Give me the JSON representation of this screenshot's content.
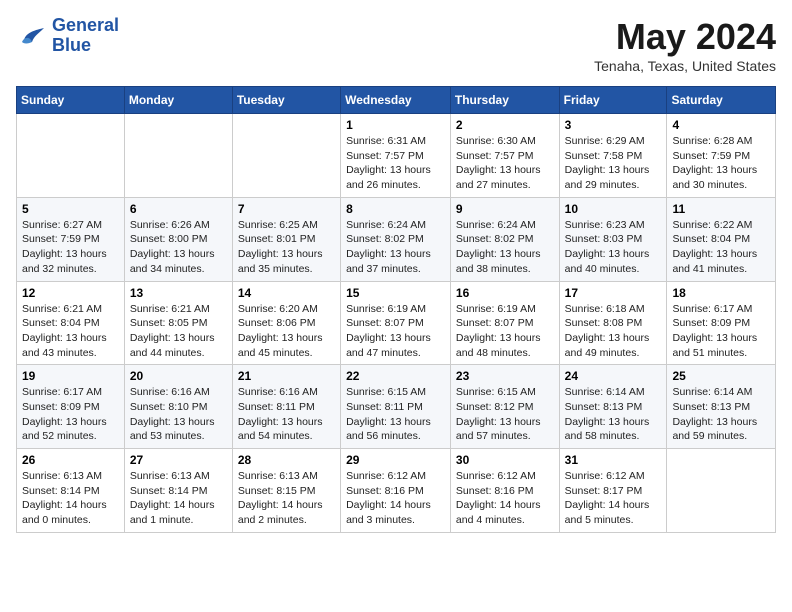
{
  "header": {
    "logo_line1": "General",
    "logo_line2": "Blue",
    "month_year": "May 2024",
    "location": "Tenaha, Texas, United States"
  },
  "days_of_week": [
    "Sunday",
    "Monday",
    "Tuesday",
    "Wednesday",
    "Thursday",
    "Friday",
    "Saturday"
  ],
  "weeks": [
    [
      {
        "day": "",
        "info": ""
      },
      {
        "day": "",
        "info": ""
      },
      {
        "day": "",
        "info": ""
      },
      {
        "day": "1",
        "info": "Sunrise: 6:31 AM\nSunset: 7:57 PM\nDaylight: 13 hours\nand 26 minutes."
      },
      {
        "day": "2",
        "info": "Sunrise: 6:30 AM\nSunset: 7:57 PM\nDaylight: 13 hours\nand 27 minutes."
      },
      {
        "day": "3",
        "info": "Sunrise: 6:29 AM\nSunset: 7:58 PM\nDaylight: 13 hours\nand 29 minutes."
      },
      {
        "day": "4",
        "info": "Sunrise: 6:28 AM\nSunset: 7:59 PM\nDaylight: 13 hours\nand 30 minutes."
      }
    ],
    [
      {
        "day": "5",
        "info": "Sunrise: 6:27 AM\nSunset: 7:59 PM\nDaylight: 13 hours\nand 32 minutes."
      },
      {
        "day": "6",
        "info": "Sunrise: 6:26 AM\nSunset: 8:00 PM\nDaylight: 13 hours\nand 34 minutes."
      },
      {
        "day": "7",
        "info": "Sunrise: 6:25 AM\nSunset: 8:01 PM\nDaylight: 13 hours\nand 35 minutes."
      },
      {
        "day": "8",
        "info": "Sunrise: 6:24 AM\nSunset: 8:02 PM\nDaylight: 13 hours\nand 37 minutes."
      },
      {
        "day": "9",
        "info": "Sunrise: 6:24 AM\nSunset: 8:02 PM\nDaylight: 13 hours\nand 38 minutes."
      },
      {
        "day": "10",
        "info": "Sunrise: 6:23 AM\nSunset: 8:03 PM\nDaylight: 13 hours\nand 40 minutes."
      },
      {
        "day": "11",
        "info": "Sunrise: 6:22 AM\nSunset: 8:04 PM\nDaylight: 13 hours\nand 41 minutes."
      }
    ],
    [
      {
        "day": "12",
        "info": "Sunrise: 6:21 AM\nSunset: 8:04 PM\nDaylight: 13 hours\nand 43 minutes."
      },
      {
        "day": "13",
        "info": "Sunrise: 6:21 AM\nSunset: 8:05 PM\nDaylight: 13 hours\nand 44 minutes."
      },
      {
        "day": "14",
        "info": "Sunrise: 6:20 AM\nSunset: 8:06 PM\nDaylight: 13 hours\nand 45 minutes."
      },
      {
        "day": "15",
        "info": "Sunrise: 6:19 AM\nSunset: 8:07 PM\nDaylight: 13 hours\nand 47 minutes."
      },
      {
        "day": "16",
        "info": "Sunrise: 6:19 AM\nSunset: 8:07 PM\nDaylight: 13 hours\nand 48 minutes."
      },
      {
        "day": "17",
        "info": "Sunrise: 6:18 AM\nSunset: 8:08 PM\nDaylight: 13 hours\nand 49 minutes."
      },
      {
        "day": "18",
        "info": "Sunrise: 6:17 AM\nSunset: 8:09 PM\nDaylight: 13 hours\nand 51 minutes."
      }
    ],
    [
      {
        "day": "19",
        "info": "Sunrise: 6:17 AM\nSunset: 8:09 PM\nDaylight: 13 hours\nand 52 minutes."
      },
      {
        "day": "20",
        "info": "Sunrise: 6:16 AM\nSunset: 8:10 PM\nDaylight: 13 hours\nand 53 minutes."
      },
      {
        "day": "21",
        "info": "Sunrise: 6:16 AM\nSunset: 8:11 PM\nDaylight: 13 hours\nand 54 minutes."
      },
      {
        "day": "22",
        "info": "Sunrise: 6:15 AM\nSunset: 8:11 PM\nDaylight: 13 hours\nand 56 minutes."
      },
      {
        "day": "23",
        "info": "Sunrise: 6:15 AM\nSunset: 8:12 PM\nDaylight: 13 hours\nand 57 minutes."
      },
      {
        "day": "24",
        "info": "Sunrise: 6:14 AM\nSunset: 8:13 PM\nDaylight: 13 hours\nand 58 minutes."
      },
      {
        "day": "25",
        "info": "Sunrise: 6:14 AM\nSunset: 8:13 PM\nDaylight: 13 hours\nand 59 minutes."
      }
    ],
    [
      {
        "day": "26",
        "info": "Sunrise: 6:13 AM\nSunset: 8:14 PM\nDaylight: 14 hours\nand 0 minutes."
      },
      {
        "day": "27",
        "info": "Sunrise: 6:13 AM\nSunset: 8:14 PM\nDaylight: 14 hours\nand 1 minute."
      },
      {
        "day": "28",
        "info": "Sunrise: 6:13 AM\nSunset: 8:15 PM\nDaylight: 14 hours\nand 2 minutes."
      },
      {
        "day": "29",
        "info": "Sunrise: 6:12 AM\nSunset: 8:16 PM\nDaylight: 14 hours\nand 3 minutes."
      },
      {
        "day": "30",
        "info": "Sunrise: 6:12 AM\nSunset: 8:16 PM\nDaylight: 14 hours\nand 4 minutes."
      },
      {
        "day": "31",
        "info": "Sunrise: 6:12 AM\nSunset: 8:17 PM\nDaylight: 14 hours\nand 5 minutes."
      },
      {
        "day": "",
        "info": ""
      }
    ]
  ]
}
